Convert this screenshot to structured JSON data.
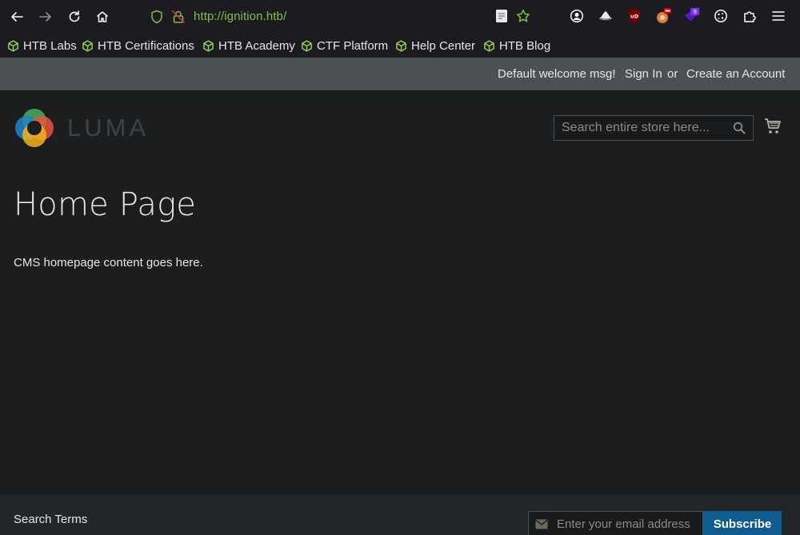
{
  "browser": {
    "url_scheme": "http://",
    "url_host": "ignition.htb/",
    "extension_badge": "9",
    "bookmarks": [
      {
        "label": "HTB Labs"
      },
      {
        "label": "HTB Certifications"
      },
      {
        "label": "HTB Academy"
      },
      {
        "label": "CTF Platform"
      },
      {
        "label": "Help Center"
      },
      {
        "label": "HTB Blog"
      }
    ]
  },
  "header": {
    "welcome": "Default welcome msg!",
    "sign_in": "Sign In",
    "or": "or",
    "create_account": "Create an Account"
  },
  "store": {
    "logo_text": "LUMA",
    "search_placeholder": "Search entire store here..."
  },
  "main": {
    "title": "Home Page",
    "content": "CMS homepage content goes here."
  },
  "footer": {
    "search_terms": "Search Terms",
    "newsletter_placeholder": "Enter your email address",
    "subscribe": "Subscribe"
  },
  "colors": {
    "url_green": "#7cc43a",
    "bookmark_icon_green": "#8fd14f",
    "panel_header": "#4b5153",
    "subscribe_blue": "#0f5c91",
    "page_bg": "#1b1d1e"
  }
}
